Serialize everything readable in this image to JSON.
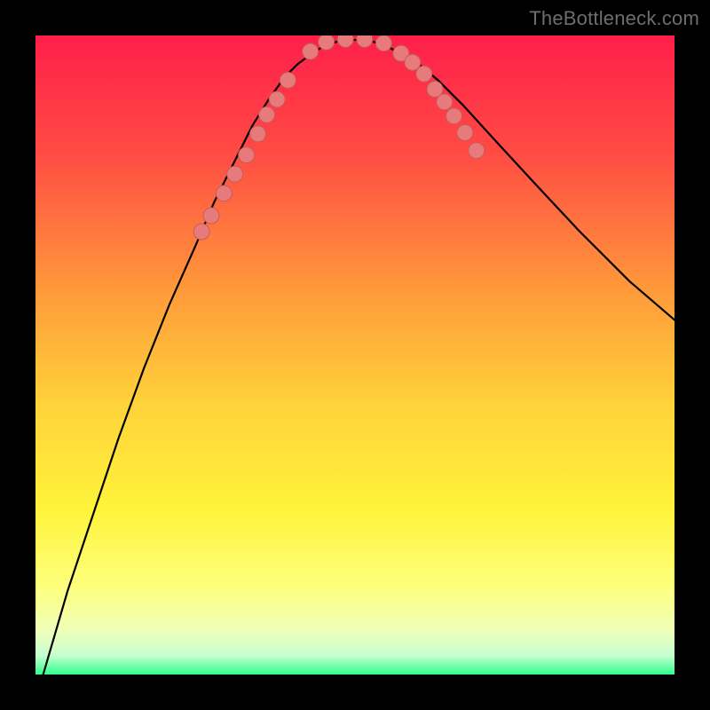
{
  "watermark": {
    "text": "TheBottleneck.com"
  },
  "chart_data": {
    "type": "line",
    "title": "",
    "xlabel": "",
    "ylabel": "",
    "xlim": [
      0,
      1
    ],
    "ylim": [
      0,
      1
    ],
    "background_gradient_stops": [
      {
        "offset": 0.0,
        "color": "#ff1e4a"
      },
      {
        "offset": 0.18,
        "color": "#ff4a44"
      },
      {
        "offset": 0.4,
        "color": "#ff9a3a"
      },
      {
        "offset": 0.58,
        "color": "#ffd33a"
      },
      {
        "offset": 0.74,
        "color": "#fff33a"
      },
      {
        "offset": 0.86,
        "color": "#fdff7a"
      },
      {
        "offset": 0.93,
        "color": "#f0ffb8"
      },
      {
        "offset": 0.97,
        "color": "#c8ffd0"
      },
      {
        "offset": 1.0,
        "color": "#2eff8e"
      }
    ],
    "series": [
      {
        "name": "curve",
        "stroke": "#000000",
        "stroke_width": 2.2,
        "x": [
          0.012,
          0.05,
          0.09,
          0.13,
          0.17,
          0.21,
          0.25,
          0.28,
          0.31,
          0.34,
          0.365,
          0.39,
          0.41,
          0.43,
          0.45,
          0.48,
          0.52,
          0.55,
          0.575,
          0.6,
          0.63,
          0.67,
          0.72,
          0.78,
          0.85,
          0.93,
          1.0
        ],
        "y": [
          0.0,
          0.13,
          0.25,
          0.37,
          0.48,
          0.58,
          0.67,
          0.74,
          0.8,
          0.86,
          0.9,
          0.935,
          0.955,
          0.97,
          0.983,
          0.993,
          0.993,
          0.983,
          0.97,
          0.955,
          0.93,
          0.89,
          0.835,
          0.77,
          0.695,
          0.615,
          0.555
        ]
      }
    ],
    "marker_points": {
      "name": "markers",
      "fill": "#e77a7a",
      "stroke": "#c85a5a",
      "r": 9,
      "x": [
        0.26,
        0.275,
        0.295,
        0.312,
        0.33,
        0.348,
        0.362,
        0.378,
        0.395,
        0.43,
        0.455,
        0.485,
        0.515,
        0.545,
        0.572,
        0.59,
        0.608,
        0.625,
        0.64,
        0.655,
        0.672,
        0.69
      ],
      "y": [
        0.693,
        0.718,
        0.753,
        0.783,
        0.813,
        0.846,
        0.876,
        0.9,
        0.93,
        0.975,
        0.99,
        0.994,
        0.994,
        0.988,
        0.972,
        0.958,
        0.94,
        0.916,
        0.896,
        0.874,
        0.848,
        0.82
      ]
    }
  }
}
